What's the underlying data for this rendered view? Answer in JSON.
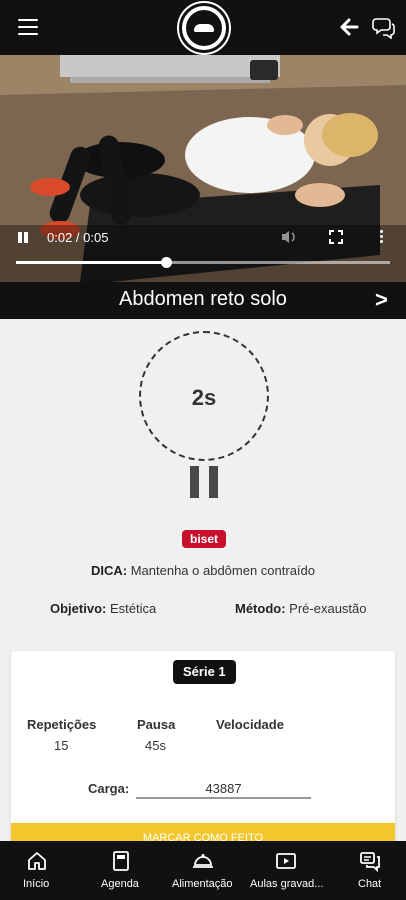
{
  "header": {
    "menu_icon": "hamburger-menu-icon",
    "logo_icon": "brand-logo-seal",
    "back_icon": "arrow-left-icon",
    "chat_icon": "chat-bubbles-icon"
  },
  "video": {
    "time_label": "0:02 / 0:05",
    "progress_fraction": 0.4,
    "play_state_icon": "pause-icon",
    "volume_icon": "volume-icon",
    "fullscreen_icon": "fullscreen-icon",
    "more_icon": "more-vert-icon"
  },
  "exercise": {
    "title": "Abdomen reto solo",
    "next_label": ">",
    "timer_label": "2s",
    "tag": "biset",
    "tip_label": "DICA:",
    "tip_text": "Mantenha o abdômen contraído",
    "objective_label": "Objetivo:",
    "objective_value": "Estética",
    "method_label": "Método:",
    "method_value": "Pré-exaustão"
  },
  "card": {
    "series_label": "Série 1",
    "reps_label": "Repetições",
    "reps_value": "15",
    "pause_label": "Pausa",
    "pause_value": "45s",
    "speed_label": "Velocidade",
    "load_label": "Carga:",
    "load_value": "43887",
    "done_label": "MARCAR COMO FEITO"
  },
  "nav": {
    "items": [
      {
        "label": "Início",
        "icon": "home-icon"
      },
      {
        "label": "Agenda",
        "icon": "agenda-book-icon"
      },
      {
        "label": "Alimentação",
        "icon": "food-cloche-icon"
      },
      {
        "label": "Aulas gravad...",
        "icon": "video-play-icon"
      },
      {
        "label": "Chat",
        "icon": "chat-icon"
      }
    ]
  },
  "colors": {
    "bar_background": "#111111",
    "tag": "#c8102e",
    "done_button": "#f2c62d",
    "page_background": "#f0f0f0"
  }
}
